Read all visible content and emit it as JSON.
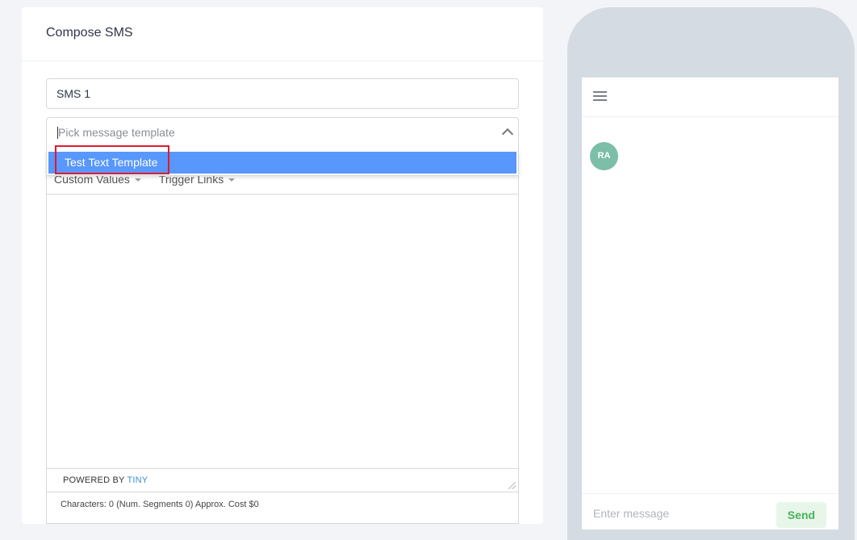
{
  "compose": {
    "title": "Compose SMS",
    "name_value": "SMS 1",
    "template_placeholder": "Pick message template",
    "template_options": [
      "Test Text Template"
    ],
    "toolbar": {
      "custom_values": "Custom Values",
      "trigger_links": "Trigger Links"
    },
    "powered_by_prefix": "POWERED BY",
    "powered_by_brand": "TINY",
    "char_info": "Characters: 0 (Num. Segments 0) Approx. Cost $0"
  },
  "phone": {
    "avatar_initials": "RA",
    "message_placeholder": "Enter message",
    "send_label": "Send"
  },
  "colors": {
    "option_highlight": "#5897fb",
    "annotation_box": "#e0192c",
    "avatar_bg": "#7cbea8",
    "send_text": "#46b45a"
  },
  "icons": [
    "chevron-up-icon",
    "chevron-down-icon",
    "menu-icon",
    "resize-grip-icon"
  ]
}
